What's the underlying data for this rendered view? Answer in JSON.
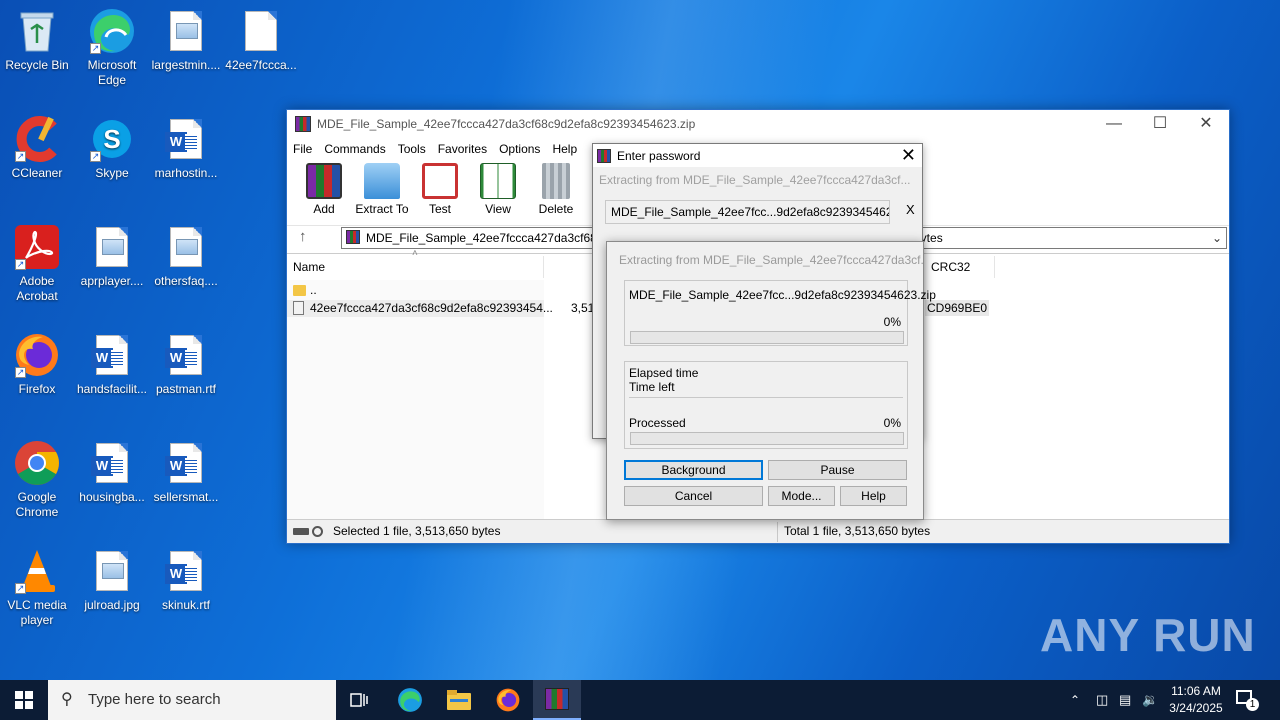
{
  "desktop": {
    "icons": [
      {
        "label": "Recycle Bin"
      },
      {
        "label": "Microsoft Edge"
      },
      {
        "label": "largestmin...."
      },
      {
        "label": "42ee7fccca..."
      },
      {
        "label": "CCleaner"
      },
      {
        "label": "Skype"
      },
      {
        "label": "marhostin..."
      },
      {
        "label": "Adobe Acrobat"
      },
      {
        "label": "aprplayer...."
      },
      {
        "label": "othersfaq...."
      },
      {
        "label": "Firefox"
      },
      {
        "label": "handsfacilit..."
      },
      {
        "label": "pastman.rtf"
      },
      {
        "label": "Google Chrome"
      },
      {
        "label": "housingba..."
      },
      {
        "label": "sellersmat..."
      },
      {
        "label": "VLC media player"
      },
      {
        "label": "julroad.jpg"
      },
      {
        "label": "skinuk.rtf"
      }
    ]
  },
  "winrar": {
    "title": "MDE_File_Sample_42ee7fccca427da3cf68c9d2efa8c92393454623.zip",
    "menu": [
      "File",
      "Commands",
      "Tools",
      "Favorites",
      "Options",
      "Help"
    ],
    "toolbar": [
      "Add",
      "Extract To",
      "Test",
      "View",
      "Delete"
    ],
    "address": "MDE_File_Sample_42ee7fccca427da3cf68c9",
    "address_tail": "0 bytes",
    "columns": {
      "name": "Name",
      "crc": "CRC32"
    },
    "rows": [
      {
        "name": "..",
        "size": "",
        "crc": ""
      },
      {
        "name": "42ee7fccca427da3cf68c9d2efa8c92393454...",
        "size": "3,51",
        "crc": "CD969BE0"
      }
    ],
    "status_left": "Selected 1 file, 3,513,650 bytes",
    "status_right": "Total 1 file, 3,513,650 bytes"
  },
  "password_dialog": {
    "title": "Enter password",
    "extracting": "Extracting from MDE_File_Sample_42ee7fccca427da3cf...",
    "file": "MDE_File_Sample_42ee7fcc...9d2efa8c92393454623.zip",
    "close_x": "X"
  },
  "extract_dialog": {
    "title": "Extracting from MDE_File_Sample_42ee7fccca427da3cf...",
    "file": "MDE_File_Sample_42ee7fcc...9d2efa8c92393454623.zip",
    "file_percent": "0%",
    "file_progress": 0,
    "elapsed_label": "Elapsed time",
    "left_label": "Time left",
    "processed_label": "Processed",
    "processed_percent": "0%",
    "processed_progress": 0,
    "buttons": {
      "background": "Background",
      "pause": "Pause",
      "cancel": "Cancel",
      "mode": "Mode...",
      "help": "Help"
    }
  },
  "watermark": "ANY RUN",
  "taskbar": {
    "search_placeholder": "Type here to search",
    "time": "11:06 AM",
    "date": "3/24/2025",
    "notification_count": "1"
  }
}
